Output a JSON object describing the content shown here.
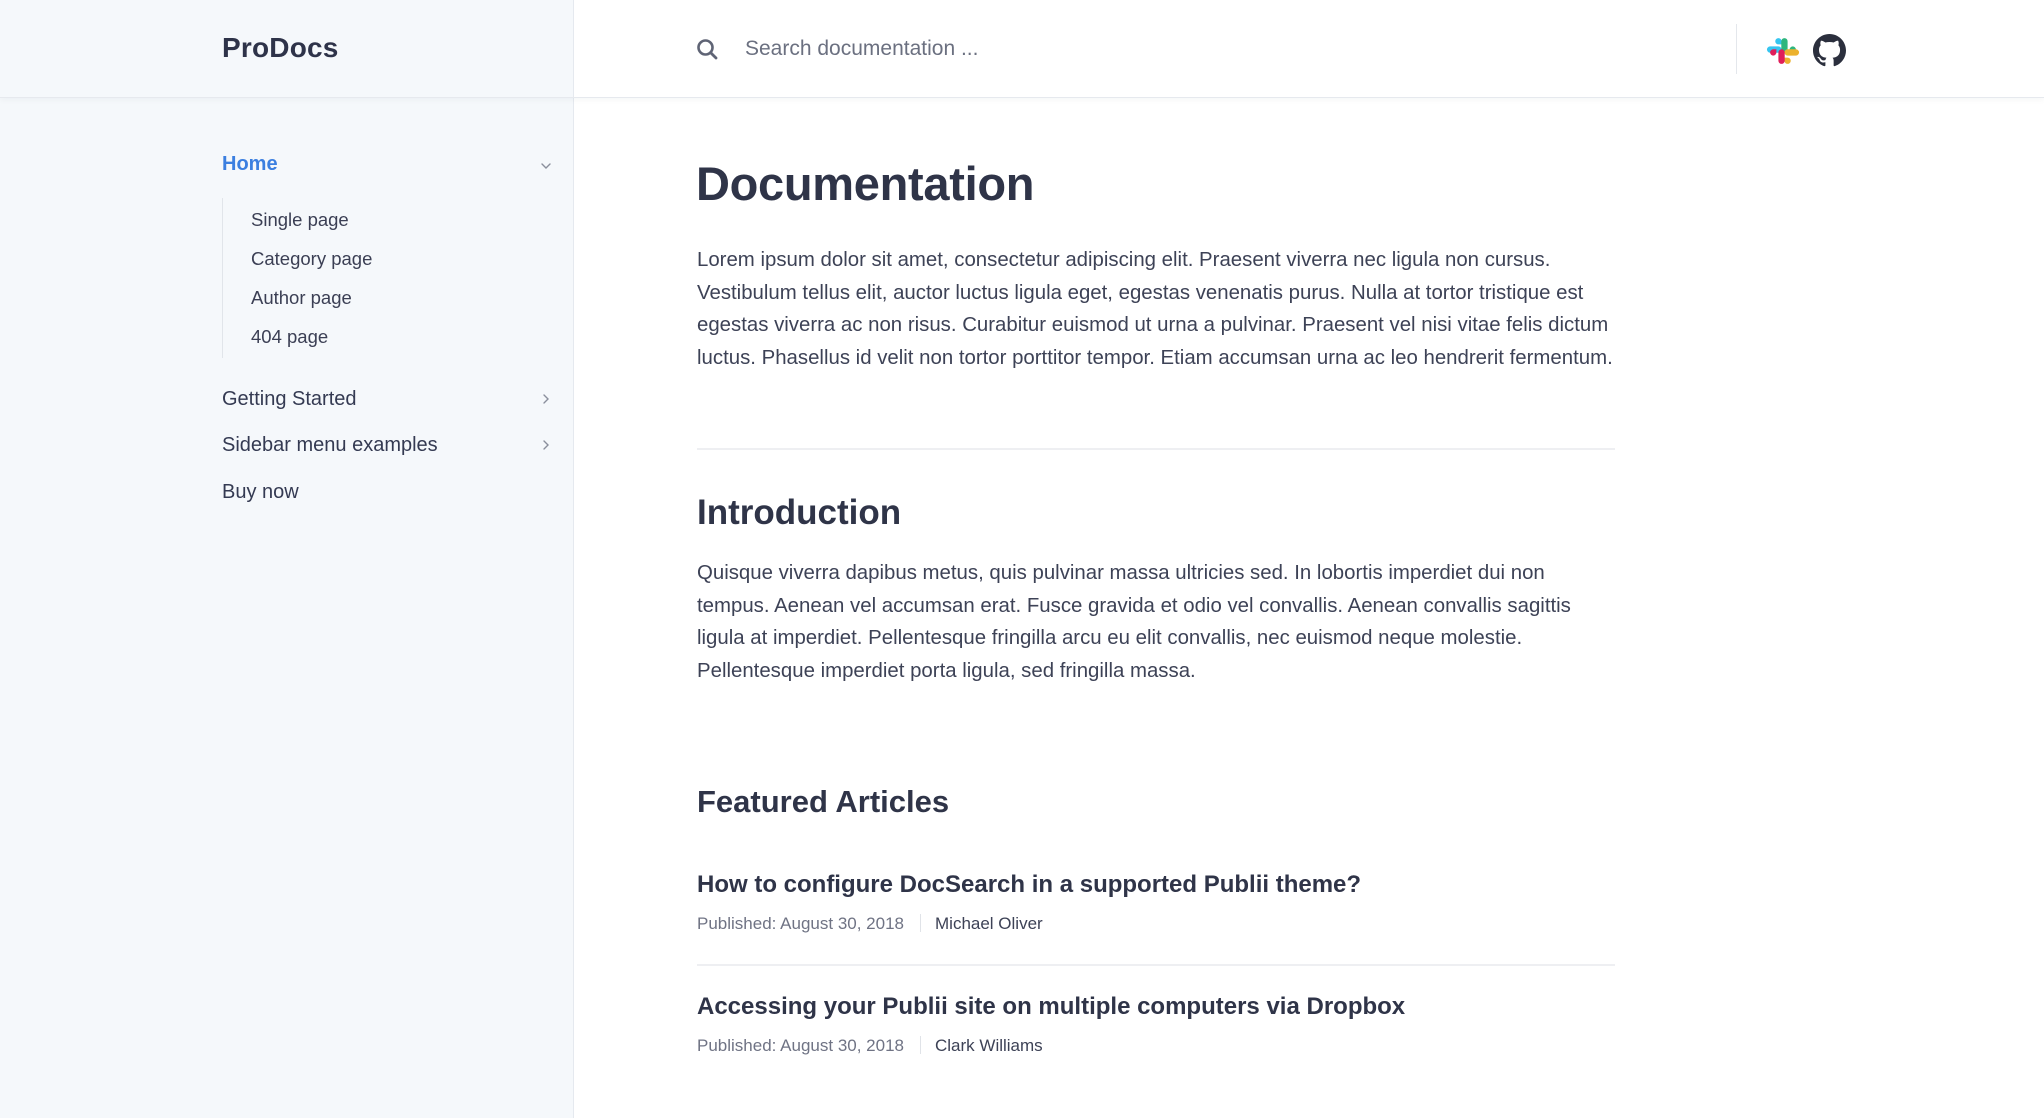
{
  "brand": {
    "name": "ProDocs"
  },
  "header": {
    "search_placeholder": "Search documentation ...",
    "search_value": "",
    "icons": [
      "search-icon",
      "slack-icon",
      "github-icon"
    ]
  },
  "sidebar": {
    "items": [
      {
        "label": "Home",
        "active": true,
        "expanded": true,
        "icon": "chevron-down-icon",
        "children": [
          {
            "label": "Single page"
          },
          {
            "label": "Category page"
          },
          {
            "label": "Author page"
          },
          {
            "label": "404 page"
          }
        ]
      },
      {
        "label": "Getting Started",
        "icon": "chevron-right-icon"
      },
      {
        "label": "Sidebar menu examples",
        "icon": "chevron-right-icon"
      },
      {
        "label": "Buy now"
      }
    ]
  },
  "main": {
    "title": "Documentation",
    "intro_paragraph": "Lorem ipsum dolor sit amet, consectetur adipiscing elit. Praesent viverra nec ligula non cursus. Vestibulum tellus elit, auctor luctus ligula eget, egestas venenatis purus. Nulla at tortor tristique est egestas viverra ac non risus. Curabitur euismod ut urna a pulvinar. Praesent vel nisi vitae felis dictum luctus. Phasellus id velit non tortor porttitor tempor. Etiam accumsan urna ac leo hendrerit fermentum.",
    "introduction": {
      "heading": "Introduction",
      "paragraph": "Quisque viverra dapibus metus, quis pulvinar massa ultricies sed. In lobortis imperdiet dui non tempus. Aenean vel accumsan erat. Fusce gravida et odio vel convallis. Aenean convallis sagittis ligula at imperdiet. Pellentesque fringilla arcu eu elit convallis, nec euismod neque molestie. Pellentesque imperdiet porta ligula, sed fringilla massa."
    },
    "featured": {
      "heading": "Featured Articles",
      "articles": [
        {
          "title": "How to configure DocSearch in a supported Publii theme?",
          "published": "Published: August 30, 2018",
          "author": "Michael Oliver"
        },
        {
          "title": "Accessing your Publii site on multiple computers via Dropbox",
          "published": "Published: August 30, 2018",
          "author": "Clark Williams"
        }
      ]
    }
  },
  "colors": {
    "accent": "#3b7fe0",
    "sidebar_bg": "#f5f8fb",
    "text": "#343a52",
    "muted": "#6f7384"
  }
}
